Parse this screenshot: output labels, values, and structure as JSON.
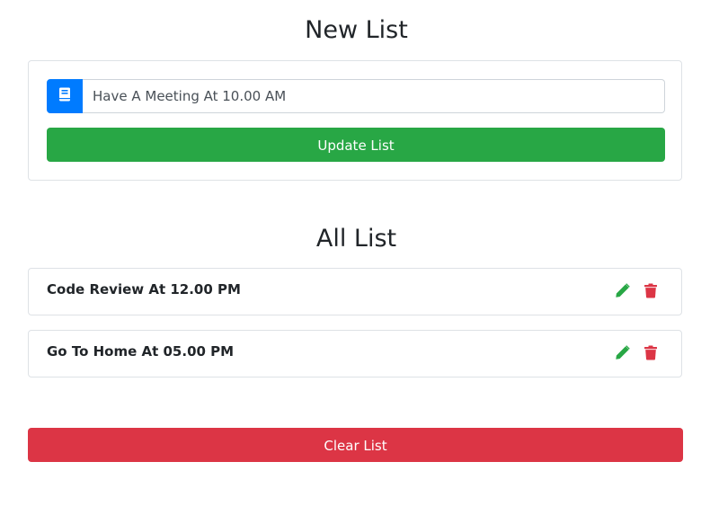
{
  "new_list": {
    "heading": "New List",
    "input_value": "Have A Meeting At 10.00 AM",
    "update_label": "Update List"
  },
  "all_list": {
    "heading": "All List",
    "items": [
      {
        "text": "Code Review At 12.00 PM"
      },
      {
        "text": "Go To Home At 05.00 PM"
      }
    ]
  },
  "clear_label": "Clear List",
  "icons": {
    "input_prepend": "book-icon",
    "edit": "pencil-icon",
    "delete": "trash-icon"
  },
  "colors": {
    "primary": "#007bff",
    "success": "#28a745",
    "danger": "#dc3545"
  }
}
